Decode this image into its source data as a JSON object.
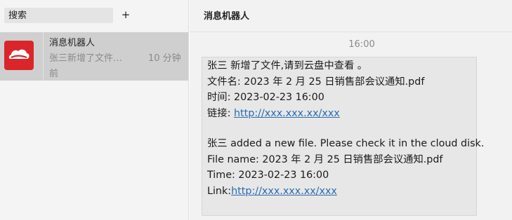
{
  "sidebar": {
    "search_placeholder": "搜索",
    "add_label": "+",
    "conversations": [
      {
        "name": "消息机器人",
        "preview": "张三新增了文件…",
        "time_part1": "10 分钟",
        "time_part2": "前",
        "avatar_icon": "cloud-icon",
        "avatar_color": "#d9262b"
      }
    ]
  },
  "chat": {
    "title": "消息机器人",
    "timestamp": "16:00",
    "message": {
      "zh_line1": "张三  新增了文件,请到云盘中查看 。",
      "zh_filename_label": "文件名: ",
      "zh_filename": "2023 年 2 月 25 日销售部会议通知.pdf",
      "zh_time_label": "时间: ",
      "zh_time": "2023-02-23 16:00",
      "zh_link_label": "链接: ",
      "zh_link": "http://xxx.xxx.xx/xxx",
      "en_line1": "张三  added a new file. Please check it in the cloud disk.",
      "en_filename_label": "File name: ",
      "en_filename": "2023 年 2 月 25 日销售部会议通知.pdf",
      "en_time_label": "Time: ",
      "en_time": "2023-02-23 16:00",
      "en_link_label": "Link:",
      "en_link": "http://xxx.xxx.xx/xxx"
    }
  },
  "colors": {
    "sidebar_bg": "#f4f4f4",
    "selected_bg": "#cfcfcf",
    "chat_bg": "#f2f2f2",
    "bubble_bg": "#e7e7e7",
    "link": "#2a6ab2",
    "avatar": "#d9262b"
  }
}
